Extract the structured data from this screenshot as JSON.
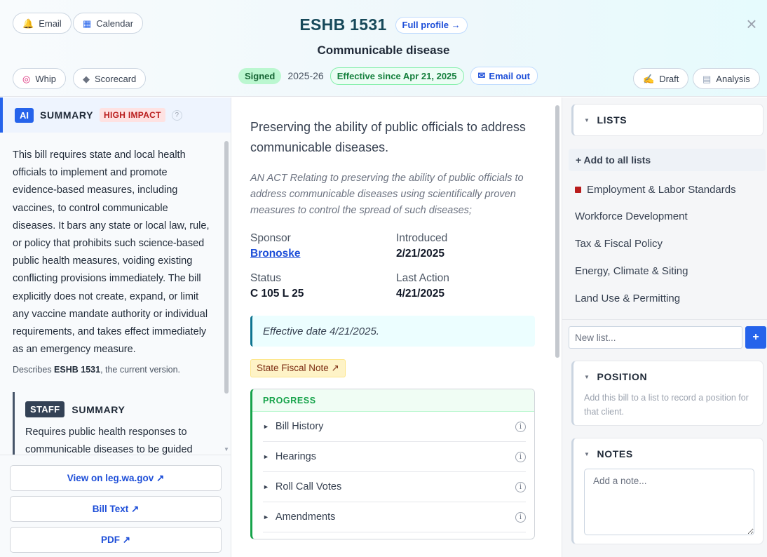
{
  "header": {
    "email_label": "Email",
    "calendar_label": "Calendar",
    "whip_label": "Whip",
    "scorecard_label": "Scorecard",
    "bill_id": "ESHB 1531",
    "full_profile_label": "Full profile →",
    "title": "Communicable disease",
    "status_badge": "Signed",
    "session": "2025-26",
    "effective_badge": "Effective since Apr 21, 2025",
    "email_out_label": "Email out",
    "draft_label": "Draft",
    "analysis_label": "Analysis",
    "close_glyph": "×"
  },
  "left": {
    "ai_tag": "AI",
    "summary_title": "SUMMARY",
    "impact_badge": "HIGH IMPACT",
    "help_glyph": "?",
    "summary_text": "This bill requires state and local health officials to implement and promote evidence-based measures, including vaccines, to control communicable diseases. It bars any state or local law, rule, or policy that prohibits such science-based public health measures, voiding existing conflicting provisions immediately. The bill explicitly does not create, expand, or limit any vaccine mandate authority or individual requirements, and takes effect immediately as an emergency measure.",
    "describes_prefix": "Describes ",
    "describes_bill": "ESHB 1531",
    "describes_suffix": ", the current version.",
    "staff_tag": "STAFF",
    "staff_title": "SUMMARY",
    "staff_text": "Requires public health responses to communicable diseases to be guided",
    "links": [
      "View on leg.wa.gov ↗",
      "Bill Text ↗",
      "PDF ↗"
    ]
  },
  "middle": {
    "title": "Preserving the ability of public officials to address communicable diseases.",
    "act_text": "AN ACT Relating to preserving the ability of public officials to address communicable diseases using scientifically proven measures to control the spread of such diseases;",
    "sponsor_label": "Sponsor",
    "sponsor_value": "Bronoske",
    "introduced_label": "Introduced",
    "introduced_value": "2/21/2025",
    "status_label": "Status",
    "status_value": "C 105 L 25",
    "last_action_label": "Last Action",
    "last_action_value": "4/21/2025",
    "effective_note": "Effective date 4/21/2025.",
    "fiscal_note": "State Fiscal Note ↗",
    "progress_title": "PROGRESS",
    "progress_items": [
      "Bill History",
      "Hearings",
      "Roll Call Votes",
      "Amendments"
    ]
  },
  "right": {
    "lists_title": "LISTS",
    "add_all": "+ Add to all lists",
    "lists": [
      "Employment & Labor Standards",
      "Workforce Development",
      "Tax & Fiscal Policy",
      "Energy, Climate & Siting",
      "Land Use & Permitting"
    ],
    "new_list_placeholder": "New list...",
    "plus_label": "+",
    "position_title": "POSITION",
    "position_text": "Add this bill to a list to record a position for that client.",
    "notes_title": "NOTES",
    "note_placeholder": "Add a note..."
  },
  "colors": {
    "accent": "#2563eb",
    "bill_id": "#17495a",
    "signed_bg": "#bbf7d0",
    "progress_green": "#16a34a",
    "list_dot": "#b91c1c"
  },
  "icons": {
    "email": "bell-icon",
    "calendar": "calendar-icon",
    "whip": "target-icon",
    "scorecard": "scorecard-icon",
    "email_out": "envelope-icon",
    "draft": "pencil-hand-icon",
    "analysis": "document-icon",
    "close": "close-icon"
  }
}
